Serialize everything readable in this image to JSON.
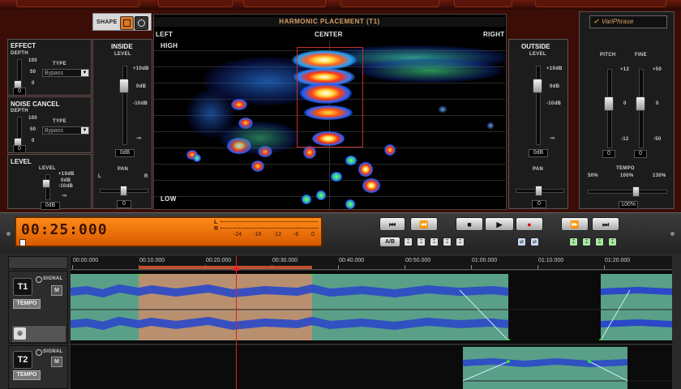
{
  "shape": {
    "label": "SHAPE"
  },
  "effect": {
    "title": "EFFECT",
    "depth_label": "DEPTH",
    "scale": [
      "100",
      "50",
      "0"
    ],
    "type_label": "TYPE",
    "type_value": "Bypass",
    "value": "0"
  },
  "noise_cancel": {
    "title": "NOISE CANCEL",
    "depth_label": "DEPTH",
    "scale": [
      "100",
      "50",
      "0"
    ],
    "type_label": "TYPE",
    "type_value": "Bypass",
    "value": "0"
  },
  "level": {
    "title": "LEVEL",
    "sub_label": "LEVEL",
    "scale": [
      "+10dB",
      "0dB",
      "-10dB",
      "-∞"
    ],
    "value": "0dB"
  },
  "inside": {
    "title": "INSIDE",
    "sub_label": "LEVEL",
    "scale": [
      "+10dB",
      "0dB",
      "-10dB",
      "-∞"
    ],
    "value": "0dB",
    "pan_label": "PAN",
    "pan_l": "L",
    "pan_r": "R",
    "pan_value": "0"
  },
  "harmonic": {
    "title": "HARMONIC PLACEMENT (T1)",
    "left": "LEFT",
    "center": "CENTER",
    "right": "RIGHT",
    "high": "HIGH",
    "low": "LOW"
  },
  "outside": {
    "title": "OUTSIDE",
    "sub_label": "LEVEL",
    "scale": [
      "+10dB",
      "0dB",
      "-10dB",
      "-∞"
    ],
    "value": "0dB",
    "pan_label": "PAN",
    "pan_value": "0"
  },
  "variphrase": {
    "brand": "VariPhrase",
    "pitch_label": "PITCH",
    "fine_label": "FINE",
    "pitch_scale": [
      "+12",
      "0",
      "-12"
    ],
    "fine_scale": [
      "+50",
      "0",
      "-50"
    ],
    "pitch_value": "0",
    "fine_value": "0",
    "tempo_label": "TEMPO",
    "tempo_scale": [
      "50%",
      "100%",
      "130%"
    ],
    "tempo_value": "100%"
  },
  "transport": {
    "time": "00:25:000",
    "meter_l": "L",
    "meter_r": "R",
    "meter_scale": [
      "-24",
      "-18",
      "-12",
      "-6",
      "0"
    ],
    "rewind_start": "⏮",
    "rewind": "⏪",
    "stop": "■",
    "play": "▶",
    "record": "●",
    "forward": "⏩",
    "forward_end": "⏭",
    "ab_label": "A/B"
  },
  "timeline": {
    "marks": [
      "00:00.000",
      "00:10.000",
      "00:20.000",
      "00:30.000",
      "00:40.000",
      "00:50.000",
      "01:00.000",
      "01:10.000",
      "01:20.000"
    ]
  },
  "tracks": [
    {
      "num": "T1",
      "signal": "SIGNAL",
      "mute": "M",
      "tempo": "TEMPO"
    },
    {
      "num": "T2",
      "signal": "SIGNAL",
      "mute": "M",
      "tempo": "TEMPO"
    }
  ],
  "colors": {
    "accent": "#d7a064",
    "lcd": "#ff8a18",
    "clip": "#5aa088",
    "wave": "#2a48c8",
    "selection": "#b89070"
  }
}
